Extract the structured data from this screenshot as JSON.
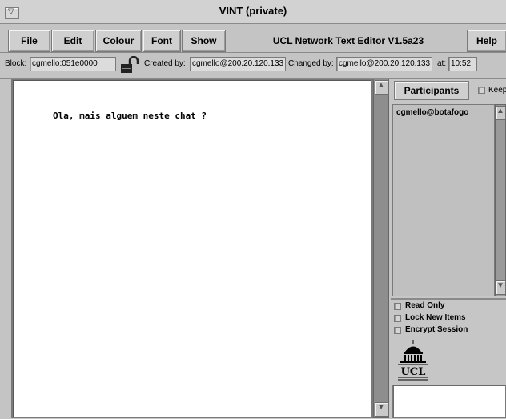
{
  "window": {
    "title": "VINT (private)"
  },
  "menu": {
    "items": [
      {
        "label": "File"
      },
      {
        "label": "Edit"
      },
      {
        "label": "Colour"
      },
      {
        "label": "Font"
      },
      {
        "label": "Show"
      }
    ],
    "app_title": "UCL Network Text Editor V1.5a23",
    "help": "Help"
  },
  "info": {
    "block_label": "Block:",
    "block_value": "cgmello:051e0000",
    "created_label": "Created by:",
    "created_value": "cgmello@200.20.120.133",
    "changed_label": "Changed by:",
    "changed_value": "cgmello@200.20.120.133",
    "at_label": "at:",
    "at_value": "10:52"
  },
  "editor": {
    "text": "Ola, mais alguem neste chat ?"
  },
  "side": {
    "participants_label": "Participants",
    "keep_label": "Keep",
    "participants": [
      "cgmello@botafogo"
    ],
    "options": [
      {
        "label": "Read Only"
      },
      {
        "label": "Lock New Items"
      },
      {
        "label": "Encrypt Session"
      }
    ],
    "logo_text": "UCL"
  },
  "colors": {
    "chrome": "#c4c4c4",
    "scroll_trough": "#8e8e8e",
    "editor_bg": "#ffffff"
  },
  "icons": [
    "window-menu-icon",
    "padlock-open-icon",
    "scroll-up-arrow-icon",
    "scroll-down-arrow-icon",
    "ucl-logo-icon"
  ]
}
